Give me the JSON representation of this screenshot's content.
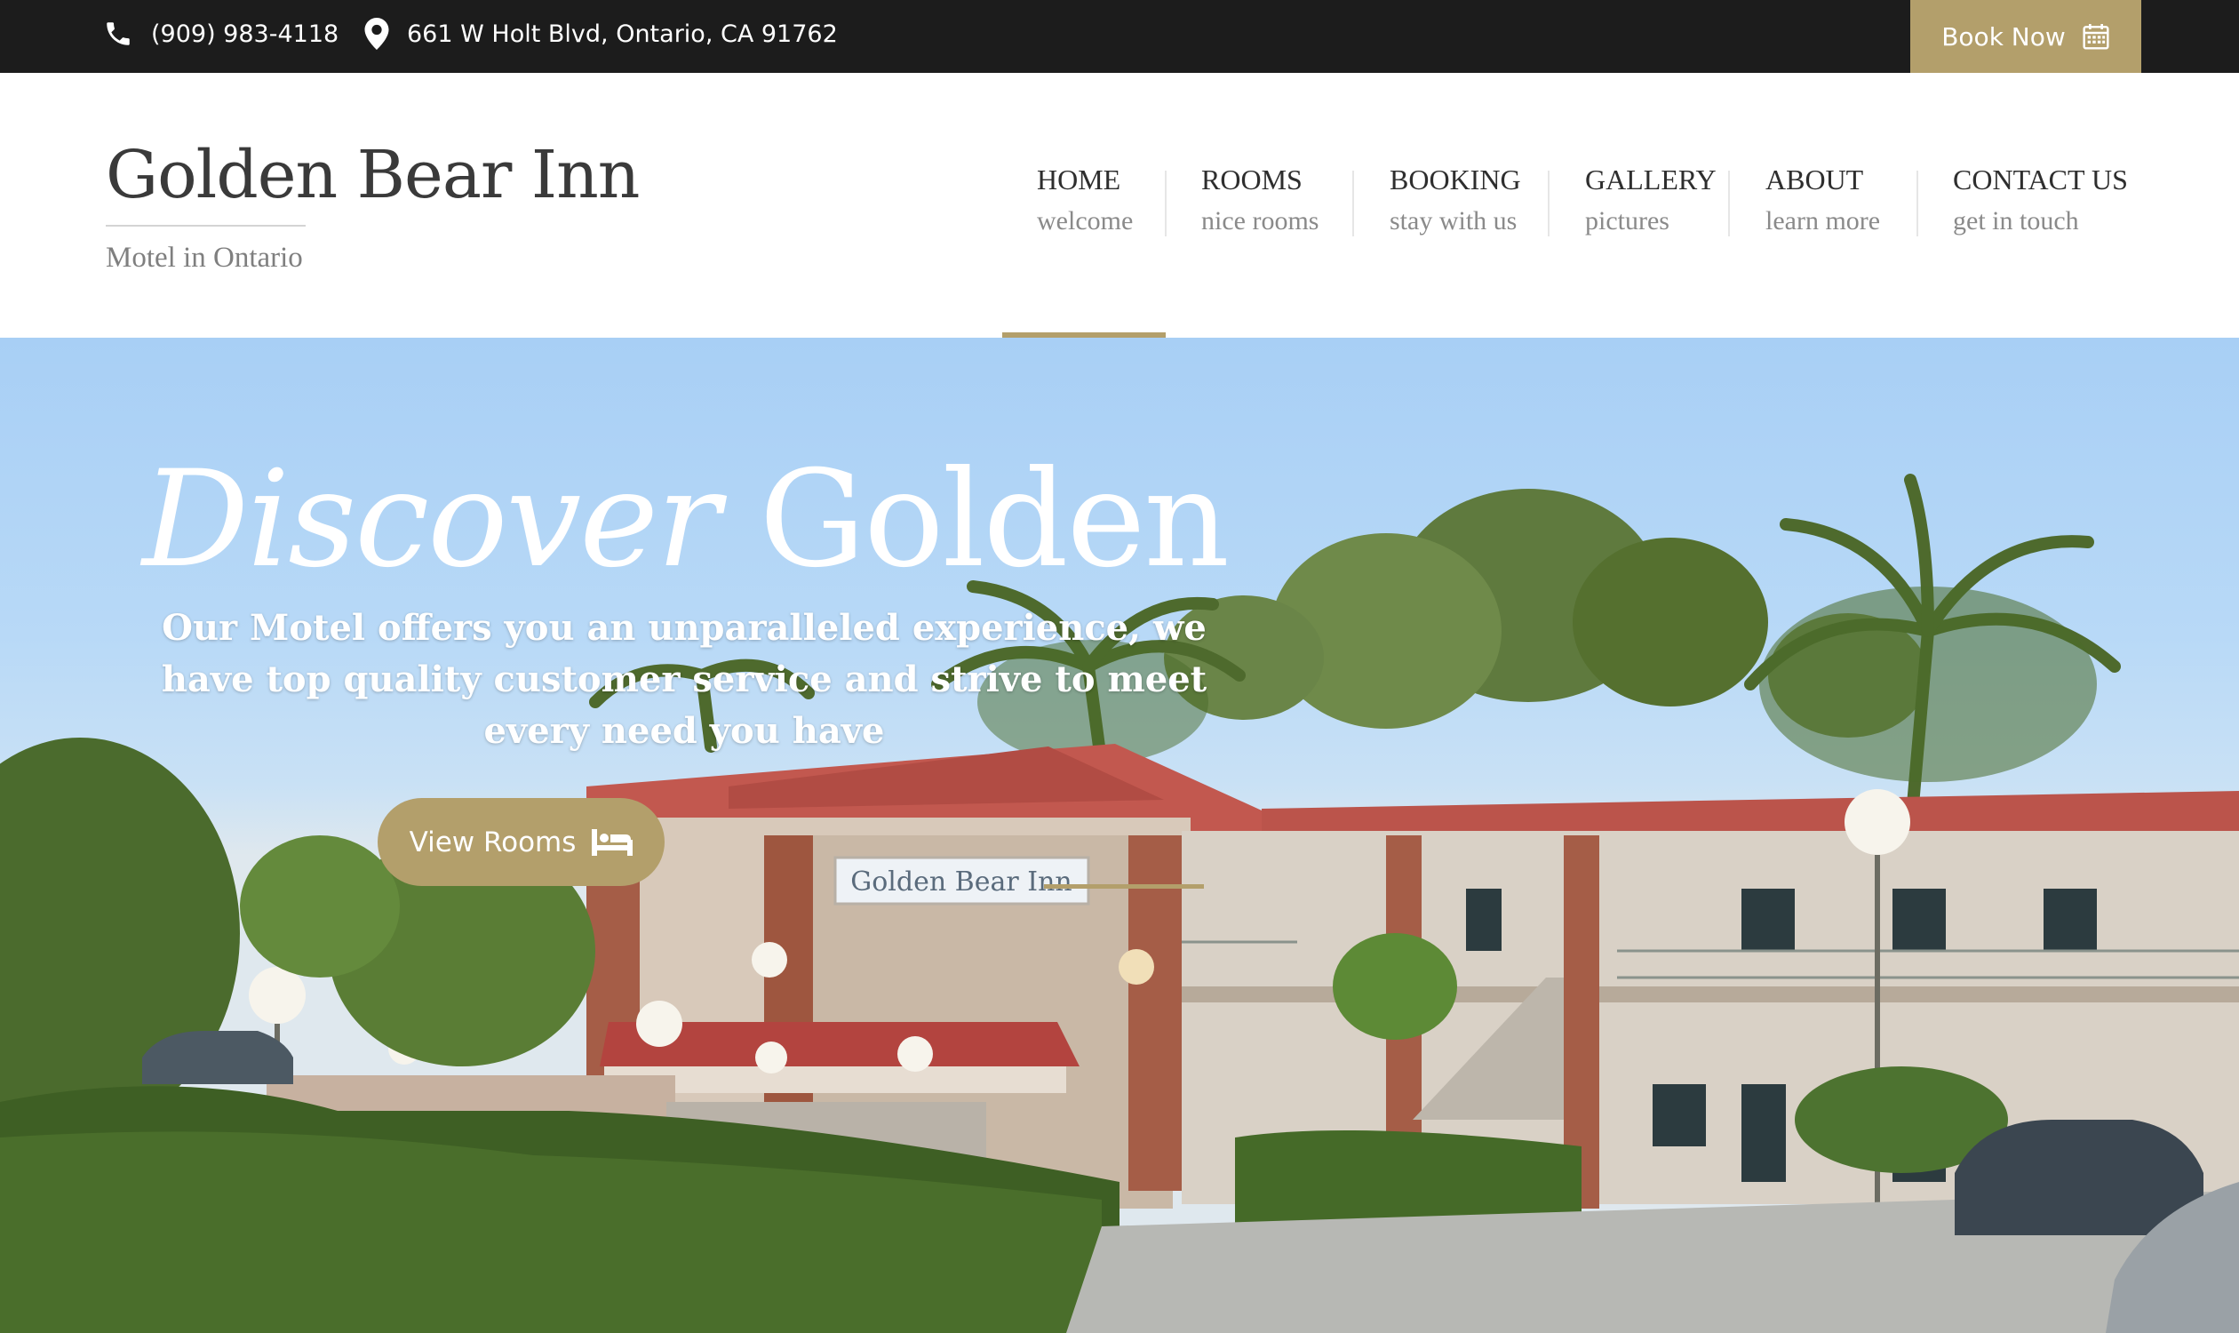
{
  "topbar": {
    "phone": "(909) 983-4118",
    "address": "661 W Holt Blvd, Ontario, CA 91762",
    "book_label": "Book Now",
    "phone_icon": "phone-icon",
    "address_icon": "map-marker-icon",
    "book_icon": "calendar-icon"
  },
  "brand": {
    "name": "Golden Bear Inn",
    "tagline": "Motel in Ontario"
  },
  "nav": {
    "items": [
      {
        "title": "HOME",
        "subtitle": "welcome",
        "active": true
      },
      {
        "title": "ROOMS",
        "subtitle": "nice rooms"
      },
      {
        "title": "BOOKING",
        "subtitle": "stay with us"
      },
      {
        "title": "GALLERY",
        "subtitle": "pictures"
      },
      {
        "title": "ABOUT",
        "subtitle": "learn more"
      },
      {
        "title": "CONTACT US",
        "subtitle": "get in touch"
      }
    ]
  },
  "hero": {
    "title_italic": "Discover",
    "title_rest": "Golden",
    "subtitle": "Our Motel offers you an unparalleled experience, we have top quality customer service and strive to meet every need you have",
    "button_label": "View Rooms",
    "button_icon": "bed-icon",
    "sign_text": "Golden Bear Inn"
  },
  "colors": {
    "accent": "#b39f6b",
    "topbar": "#1c1c1c",
    "text": "#3a3a3a"
  }
}
